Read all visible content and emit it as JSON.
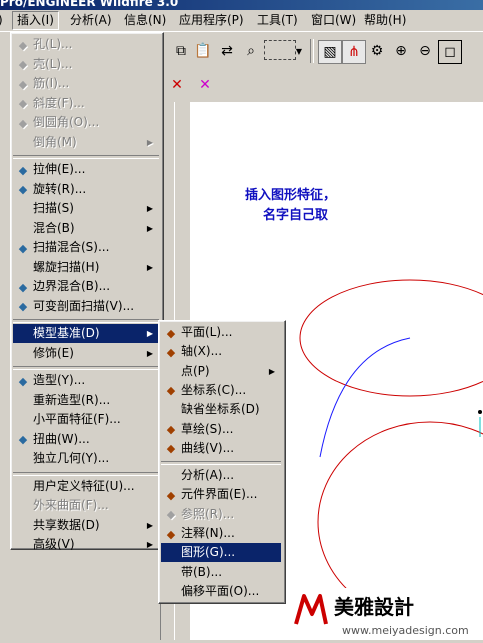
{
  "titlebar": {
    "text": "Pro/ENGINEER Wildfire 3.0"
  },
  "menubar": {
    "items": [
      "插入(I)",
      "分析(A)",
      "信息(N)",
      "应用程序(P)",
      "工具(T)",
      "窗口(W)",
      "帮助(H)"
    ]
  },
  "insert_menu": {
    "items": [
      {
        "label": "孔(L)...",
        "icon": "hole-icon",
        "disabled": true
      },
      {
        "label": "壳(L)...",
        "icon": "shell-icon",
        "disabled": true
      },
      {
        "label": "筋(I)...",
        "icon": "rib-icon",
        "disabled": true
      },
      {
        "label": "斜度(F)...",
        "icon": "draft-icon",
        "disabled": true
      },
      {
        "label": "倒圆角(O)...",
        "icon": "round-icon",
        "disabled": true
      },
      {
        "label": "倒角(M)",
        "icon": "",
        "disabled": true,
        "submenu": true
      },
      {
        "label": "拉伸(E)...",
        "icon": "extrude-icon"
      },
      {
        "label": "旋转(R)...",
        "icon": "revolve-icon"
      },
      {
        "label": "扫描(S)",
        "icon": "",
        "submenu": true
      },
      {
        "label": "混合(B)",
        "icon": "",
        "submenu": true
      },
      {
        "label": "扫描混合(S)...",
        "icon": "swept-blend-icon"
      },
      {
        "label": "螺旋扫描(H)",
        "icon": "",
        "submenu": true
      },
      {
        "label": "边界混合(B)...",
        "icon": "boundary-blend-icon"
      },
      {
        "label": "可变剖面扫描(V)...",
        "icon": "variable-sweep-icon"
      },
      {
        "label": "模型基准(D)",
        "icon": "",
        "submenu": true,
        "selected": true
      },
      {
        "label": "修饰(E)",
        "icon": "",
        "submenu": true
      },
      {
        "label": "造型(Y)...",
        "icon": "style-icon"
      },
      {
        "label": "重新造型(R)...",
        "icon": ""
      },
      {
        "label": "小平面特征(F)...",
        "icon": ""
      },
      {
        "label": "扭曲(W)...",
        "icon": "warp-icon"
      },
      {
        "label": "独立几何(Y)...",
        "icon": ""
      },
      {
        "label": "用户定义特征(U)...",
        "icon": ""
      },
      {
        "label": "外来曲面(F)...",
        "icon": "",
        "disabled": true
      },
      {
        "label": "共享数据(D)",
        "icon": "",
        "submenu": true
      },
      {
        "label": "高级(V)",
        "icon": "",
        "submenu": true
      }
    ]
  },
  "datum_menu": {
    "items": [
      {
        "label": "平面(L)...",
        "icon": "plane-icon"
      },
      {
        "label": "轴(X)...",
        "icon": "axis-icon"
      },
      {
        "label": "点(P)",
        "icon": "",
        "submenu": true
      },
      {
        "label": "坐标系(C)...",
        "icon": "csys-icon"
      },
      {
        "label": "缺省坐标系(D)",
        "icon": ""
      },
      {
        "label": "草绘(S)...",
        "icon": "sketch-icon"
      },
      {
        "label": "曲线(V)...",
        "icon": "curve-icon"
      },
      {
        "label": "分析(A)...",
        "icon": ""
      },
      {
        "label": "元件界面(E)...",
        "icon": "component-interface-icon"
      },
      {
        "label": "参照(R)...",
        "icon": "reference-icon",
        "disabled": true
      },
      {
        "label": "注释(N)...",
        "icon": "note-icon"
      },
      {
        "label": "图形(G)...",
        "icon": "",
        "selected": true
      },
      {
        "label": "带(B)...",
        "icon": ""
      },
      {
        "label": "偏移平面(O)...",
        "icon": ""
      }
    ]
  },
  "annotation": {
    "line1": "插入图形特征，",
    "line2": "名字自己取"
  },
  "logo": {
    "text": "美雅設計",
    "url": "www.meiyadesign.com"
  },
  "colors": {
    "highlight": "#0a246a",
    "curve_red": "#cc0000",
    "curve_blue": "#1a1aff",
    "annotation": "#1010c0"
  }
}
